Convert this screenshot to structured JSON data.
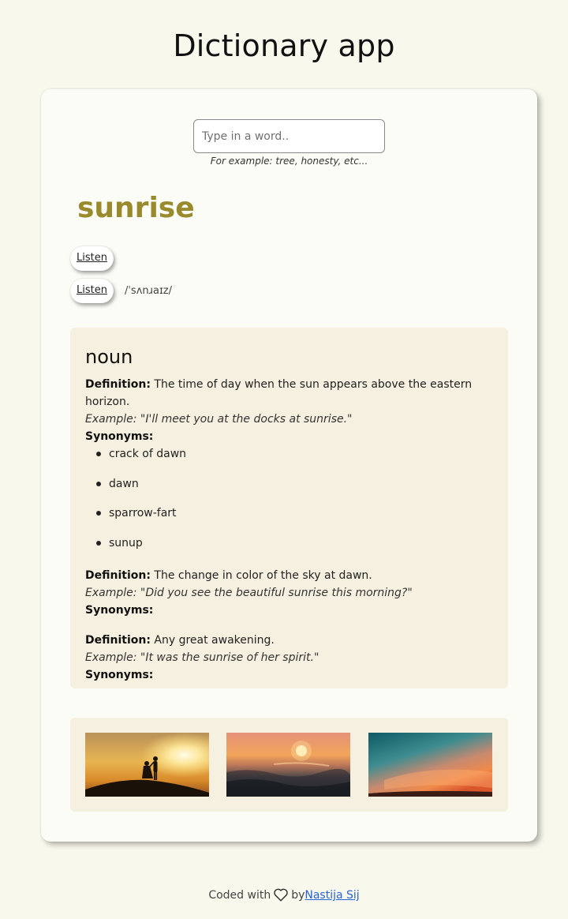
{
  "app": {
    "title": "Dictionary app"
  },
  "search": {
    "placeholder": "Type in a word..",
    "value": "",
    "hint": "For example: tree, honesty, etc..."
  },
  "word": "sunrise",
  "phonetics": [
    {
      "listen_label": "Listen",
      "text": ""
    },
    {
      "listen_label": "Listen",
      "text": "/ˈsʌnɹaɪz/"
    }
  ],
  "meaning": {
    "part_of_speech": "noun",
    "definition_label": "Definition:",
    "example_label": "Example:",
    "synonyms_label": "Synonyms:",
    "definitions": [
      {
        "definition": "The time of day when the sun appears above the eastern horizon.",
        "example": "\"I'll meet you at the docks at sunrise.\"",
        "synonyms": [
          "crack of dawn",
          "dawn",
          "sparrow-fart",
          "sunup"
        ]
      },
      {
        "definition": "The change in color of the sky at dawn.",
        "example": "\"Did you see the beautiful sunrise this morning?\"",
        "synonyms": []
      },
      {
        "definition": "Any great awakening.",
        "example": "\"It was the sunrise of her spirit.\"",
        "synonyms": []
      }
    ]
  },
  "photos": [
    {
      "icon": "photo-silhouette-sunset"
    },
    {
      "icon": "photo-ocean-sunset"
    },
    {
      "icon": "photo-teal-sky-sunset"
    }
  ],
  "footer": {
    "prefix": "Coded with",
    "heart_icon": "heart-outline-icon",
    "by": "by",
    "author": "Nastija Sij"
  },
  "colors": {
    "background": "#f8f8ec",
    "card": "#fcfcf6",
    "section": "#f5f0df",
    "accent_word": "#9a8a2e",
    "link": "#2a63d8"
  }
}
